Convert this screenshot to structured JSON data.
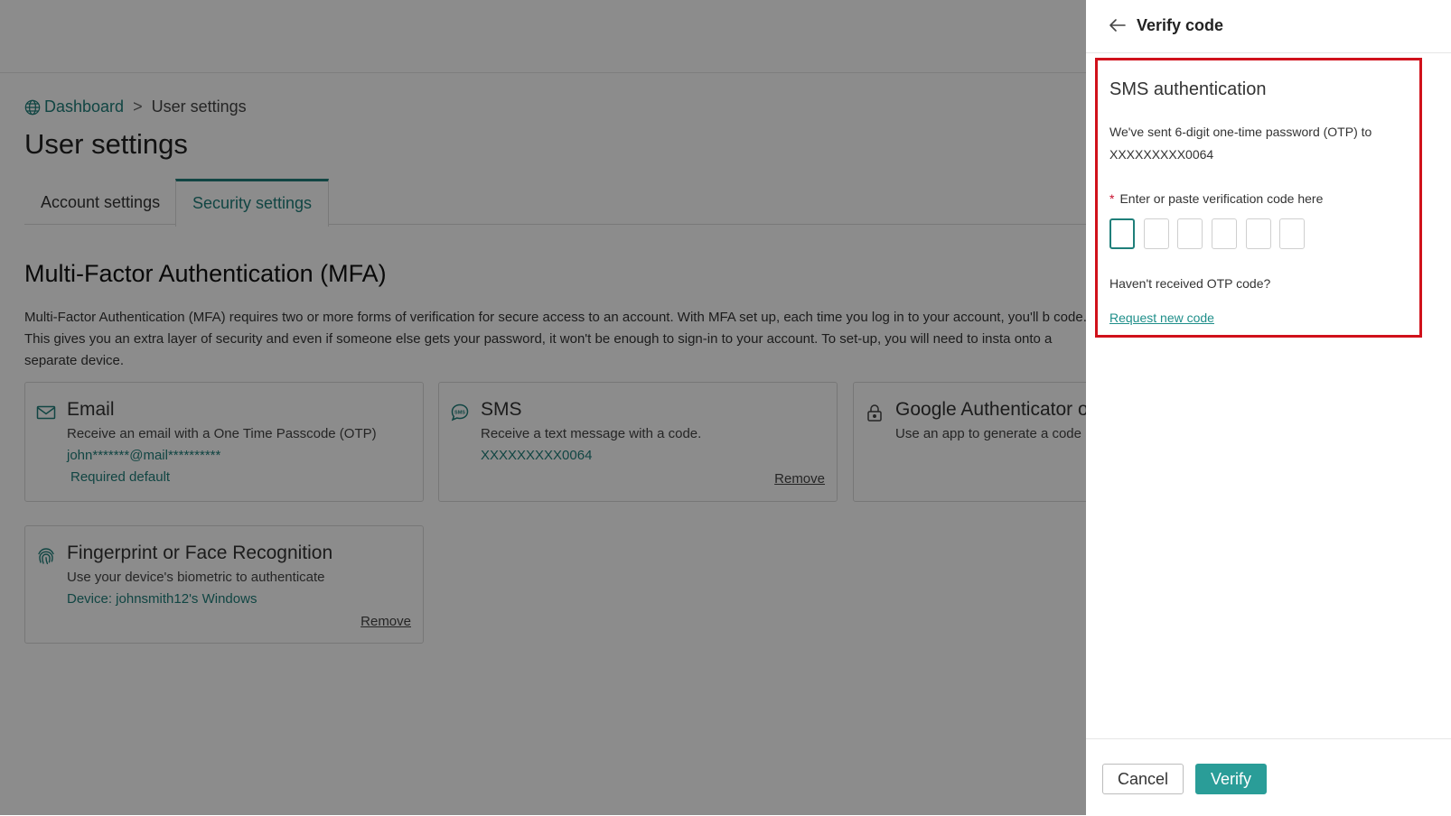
{
  "breadcrumb": {
    "home": "Dashboard",
    "separator": ">",
    "current": "User settings"
  },
  "page_title": "User settings",
  "tabs": [
    {
      "label": "Account settings"
    },
    {
      "label": "Security settings"
    }
  ],
  "mfa": {
    "title": "Multi-Factor Authentication (MFA)",
    "description": "Multi-Factor Authentication (MFA) requires two or more forms of verification for secure access to an account. With MFA set up, each time you log in to your account, you'll b code. This gives you an extra layer of security and even if someone else gets your password, it won't be enough to sign-in to your account. To set-up, you will need to insta onto a separate device.",
    "cards": [
      {
        "icon": "envelope-icon",
        "title": "Email",
        "desc": "Receive an email with a One Time Passcode (OTP)",
        "value": "john*******@mail**********",
        "badge": "Required default"
      },
      {
        "icon": "sms-icon",
        "title": "SMS",
        "desc": "Receive a text message with a code.",
        "value": "XXXXXXXXX0064",
        "remove": "Remove"
      },
      {
        "icon": "lock-icon",
        "title": "Google Authenticator or",
        "desc": "Use an app to generate a code"
      },
      {
        "icon": "fingerprint-icon",
        "title": "Fingerprint or Face Recognition",
        "desc": "Use your device's biometric to authenticate",
        "value": "Device: johnsmith12's Windows",
        "remove": "Remove"
      }
    ]
  },
  "panel": {
    "title": "Verify code",
    "sms_title": "SMS authentication",
    "message": "We've sent 6-digit one-time password (OTP) to XXXXXXXXX0064",
    "required_mark": "*",
    "code_label": "Enter or paste verification code here",
    "otp_values": [
      "",
      "",
      "",
      "",
      "",
      ""
    ],
    "no_code": "Haven't received OTP code?",
    "request_link": "Request new code",
    "cancel": "Cancel",
    "verify": "Verify"
  },
  "colors": {
    "accent": "#1f7f7a",
    "verify_button": "#2a9d98",
    "highlight_border": "#d0111b",
    "required": "#c8102e"
  }
}
